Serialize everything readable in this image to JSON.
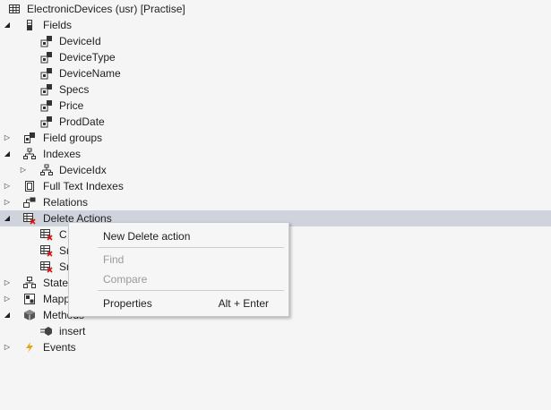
{
  "tree": {
    "root": "ElectronicDevices (usr) [Practise]",
    "fields": {
      "label": "Fields",
      "items": [
        "DeviceId",
        "DeviceType",
        "DeviceName",
        "Specs",
        "Price",
        "ProdDate"
      ]
    },
    "field_groups": "Field groups",
    "indexes": {
      "label": "Indexes",
      "items": [
        "DeviceIdx"
      ]
    },
    "full_text_indexes": "Full Text Indexes",
    "relations": "Relations",
    "delete_actions": {
      "label": "Delete Actions",
      "items": [
        "C",
        "Sr",
        "Sr"
      ]
    },
    "state": "State",
    "mappings": "Mapp",
    "methods": {
      "label": "Methods",
      "items": [
        "insert"
      ]
    },
    "events": "Events"
  },
  "context_menu": {
    "new_delete_action": "New Delete action",
    "find": "Find",
    "compare": "Compare",
    "properties": "Properties",
    "properties_shortcut": "Alt + Enter"
  },
  "colors": {
    "selection": "#cfd3dc",
    "background": "#f5f5f5",
    "disabled_text": "#9a9a9a",
    "events_icon": "#e8a317"
  }
}
